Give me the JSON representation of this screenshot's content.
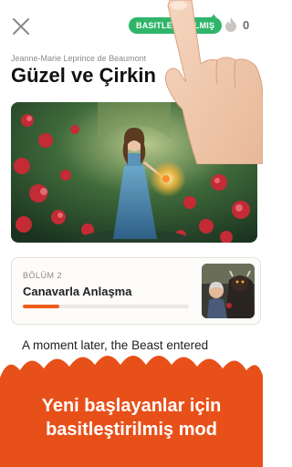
{
  "header": {
    "close_icon": "close-icon",
    "simplified_label": "BASITLEŞTIRILMIŞ",
    "streak_icon": "flame-icon",
    "streak_count": "0"
  },
  "book": {
    "author": "Jeanne-Marie Leprince de Beaumont",
    "title": "Güzel ve Çirkin"
  },
  "chapter": {
    "number_label": "BÖLÜM 2",
    "title": "Canavarla Anlaşma",
    "progress": 0.22
  },
  "reader": {
    "text_preview": "A moment later, the Beast entered"
  },
  "promo": {
    "line1": "Yeni başlayanlar için",
    "line2": "basitleştirilmiş mod"
  },
  "colors": {
    "accent": "#f05a1a",
    "badge": "#2fb56a",
    "promo_bg": "#e8501a"
  }
}
